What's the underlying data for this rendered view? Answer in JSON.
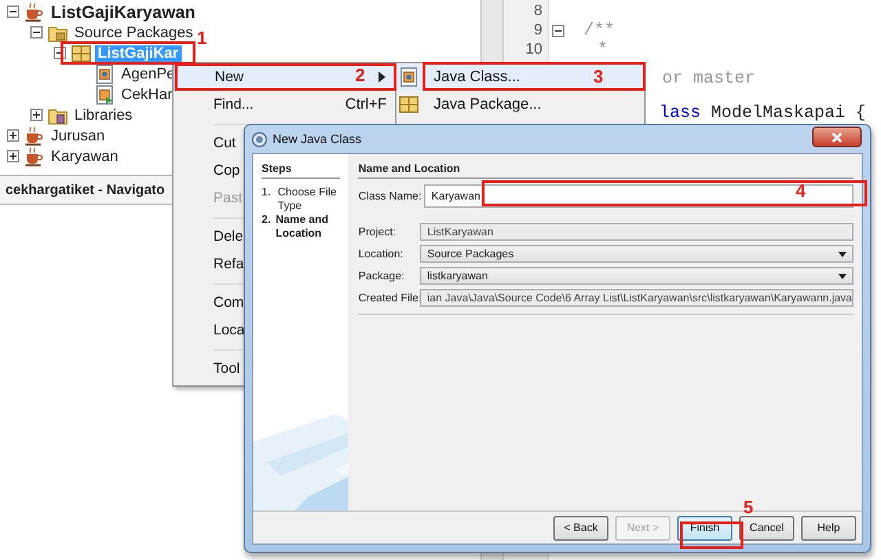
{
  "project_tree": {
    "items": [
      {
        "label": "ListGajiKaryawan",
        "kind": "project",
        "main_project": true,
        "expanded": true,
        "selected": false,
        "children": [
          {
            "label": "Source Packages",
            "kind": "folder",
            "main_project": false,
            "expanded": true,
            "selected": false,
            "children": [
              {
                "label": "ListGajiKar",
                "kind": "package",
                "main_project": false,
                "expanded": true,
                "selected": true,
                "children": [
                  {
                    "label": "AgenPe",
                    "kind": "class",
                    "main_project": false,
                    "selected": false
                  },
                  {
                    "label": "CekHar",
                    "kind": "main-class",
                    "main_project": false,
                    "selected": false
                  }
                ]
              }
            ]
          },
          {
            "label": "Libraries",
            "kind": "library",
            "main_project": false,
            "expanded": false,
            "selected": false
          }
        ]
      },
      {
        "label": "Jurusan",
        "kind": "project",
        "main_project": false,
        "expanded": false,
        "selected": false
      },
      {
        "label": "Karyawan",
        "kind": "project",
        "main_project": false,
        "expanded": false,
        "selected": false
      }
    ]
  },
  "navigator": {
    "title": "cekhargatiket - Navigato"
  },
  "editor": {
    "lines": [
      {
        "number": "8"
      },
      {
        "number": "9",
        "foldable": true,
        "code": [
          {
            "text": "/**",
            "kind": "comment"
          }
        ]
      },
      {
        "number": "10",
        "code": [
          {
            "text": "*",
            "kind": "comment"
          }
        ]
      },
      {
        "code": [
          {
            "text": "or master",
            "kind": "comment"
          }
        ]
      },
      {
        "code": [
          {
            "text": "lass",
            "kind": "keyword"
          },
          {
            "text": " ModelMaskapai {",
            "kind": "plain"
          }
        ]
      }
    ]
  },
  "context_menu": {
    "items": [
      {
        "kind": "item",
        "label": "New",
        "submenu": true,
        "selected": true,
        "disabled": false
      },
      {
        "kind": "item",
        "label": "Find...",
        "shortcut": "Ctrl+F",
        "selected": false,
        "disabled": false
      },
      {
        "kind": "separator"
      },
      {
        "kind": "item",
        "label": "Cut",
        "selected": false,
        "disabled": false
      },
      {
        "kind": "item",
        "label": "Cop",
        "selected": false,
        "disabled": false
      },
      {
        "kind": "item",
        "label": "Past",
        "selected": false,
        "disabled": true
      },
      {
        "kind": "separator"
      },
      {
        "kind": "item",
        "label": "Dele",
        "selected": false,
        "disabled": false
      },
      {
        "kind": "item",
        "label": "Refa",
        "selected": false,
        "disabled": false
      },
      {
        "kind": "separator"
      },
      {
        "kind": "item",
        "label": "Com",
        "selected": false,
        "disabled": false
      },
      {
        "kind": "item",
        "label": "Loca",
        "selected": false,
        "disabled": false
      },
      {
        "kind": "separator"
      },
      {
        "kind": "item",
        "label": "Tool",
        "selected": false,
        "disabled": false
      }
    ]
  },
  "submenu": {
    "items": [
      {
        "label": "Java Class...",
        "kind": "class",
        "selected": true
      },
      {
        "label": "Java Package...",
        "kind": "package",
        "selected": false
      }
    ]
  },
  "dialog": {
    "title": "New Java Class",
    "steps_title": "Steps",
    "steps": [
      {
        "number": "1.",
        "label": "Choose File Type",
        "selected": false
      },
      {
        "number": "2.",
        "label": "Name and Location",
        "selected": true
      }
    ],
    "panel_title": "Name and Location",
    "fields": [
      {
        "label": "Class Name:",
        "value": "Karyawan",
        "kind": "text"
      },
      {
        "label": "Project:",
        "value": "ListKaryawan",
        "kind": "readonly"
      },
      {
        "label": "Location:",
        "value": "Source Packages",
        "kind": "dropdown"
      },
      {
        "label": "Package:",
        "value": "listkaryawan",
        "kind": "dropdown"
      },
      {
        "label": "Created File:",
        "value": "ian Java\\Java\\Source Code\\6 Array List\\ListKaryawan\\src\\listkaryawan\\Karyawann.java",
        "kind": "readonly"
      }
    ],
    "buttons": [
      {
        "label": "< Back",
        "disabled": false,
        "selected": false
      },
      {
        "label": "Next >",
        "disabled": true,
        "selected": false
      },
      {
        "label": "Finish",
        "disabled": false,
        "selected": true
      },
      {
        "label": "Cancel",
        "disabled": false,
        "selected": false
      },
      {
        "label": "Help",
        "disabled": false,
        "selected": false
      }
    ]
  },
  "annotations": [
    {
      "number": "1"
    },
    {
      "number": "2"
    },
    {
      "number": "3"
    },
    {
      "number": "4"
    },
    {
      "number": "5"
    }
  ]
}
